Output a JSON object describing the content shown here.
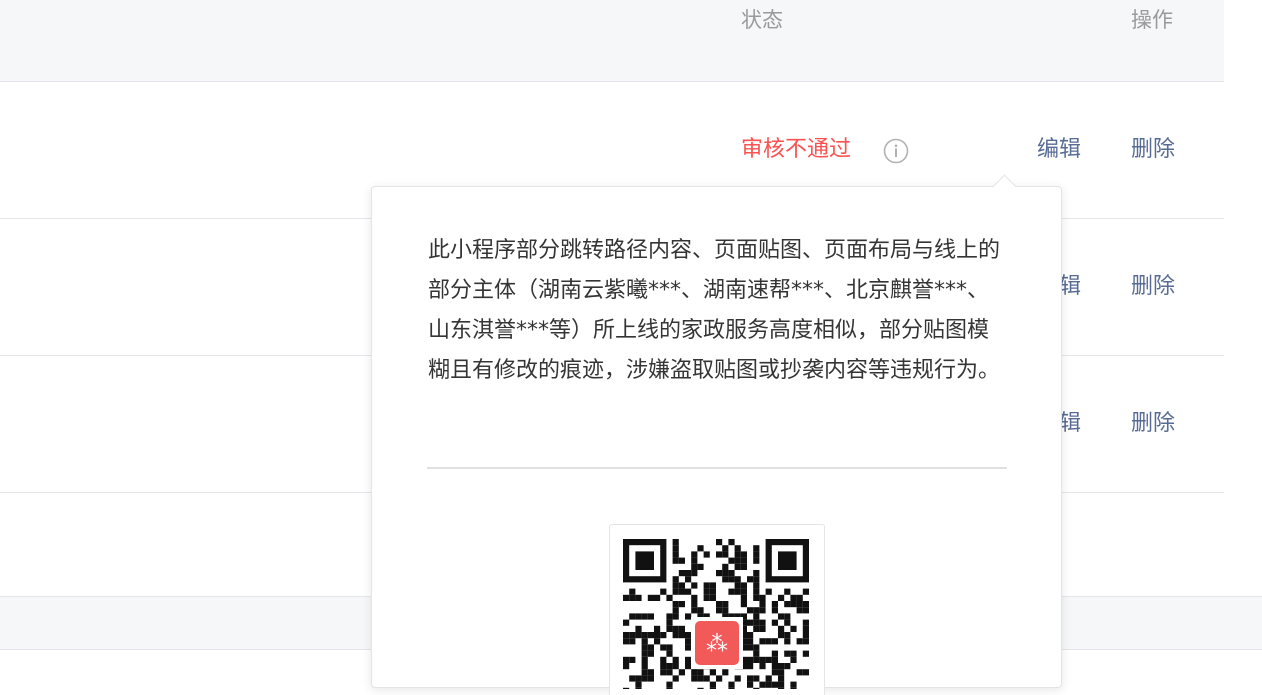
{
  "table": {
    "headers": {
      "status": "状态",
      "action": "操作"
    },
    "rows": [
      {
        "status": "审核不通过",
        "edit": "编辑",
        "delete": "删除"
      },
      {
        "edit": "编辑",
        "delete": "删除"
      },
      {
        "edit": "编辑",
        "delete": "删除"
      }
    ]
  },
  "popover": {
    "reason": "此小程序部分跳转路径内容、页面贴图、页面布局与线上的部分主体（湖南云紫曦***、湖南速帮***、北京麒誉***、山东淇誉***等）所上线的家政服务高度相似，部分贴图模糊且有修改的痕迹，涉嫌盗取贴图或抄袭内容等违规行为。",
    "qr_logo_color": "#f25a5a"
  },
  "colors": {
    "status_fail": "#fa5151",
    "link": "#576b95",
    "header_bg": "#f6f7f9"
  }
}
